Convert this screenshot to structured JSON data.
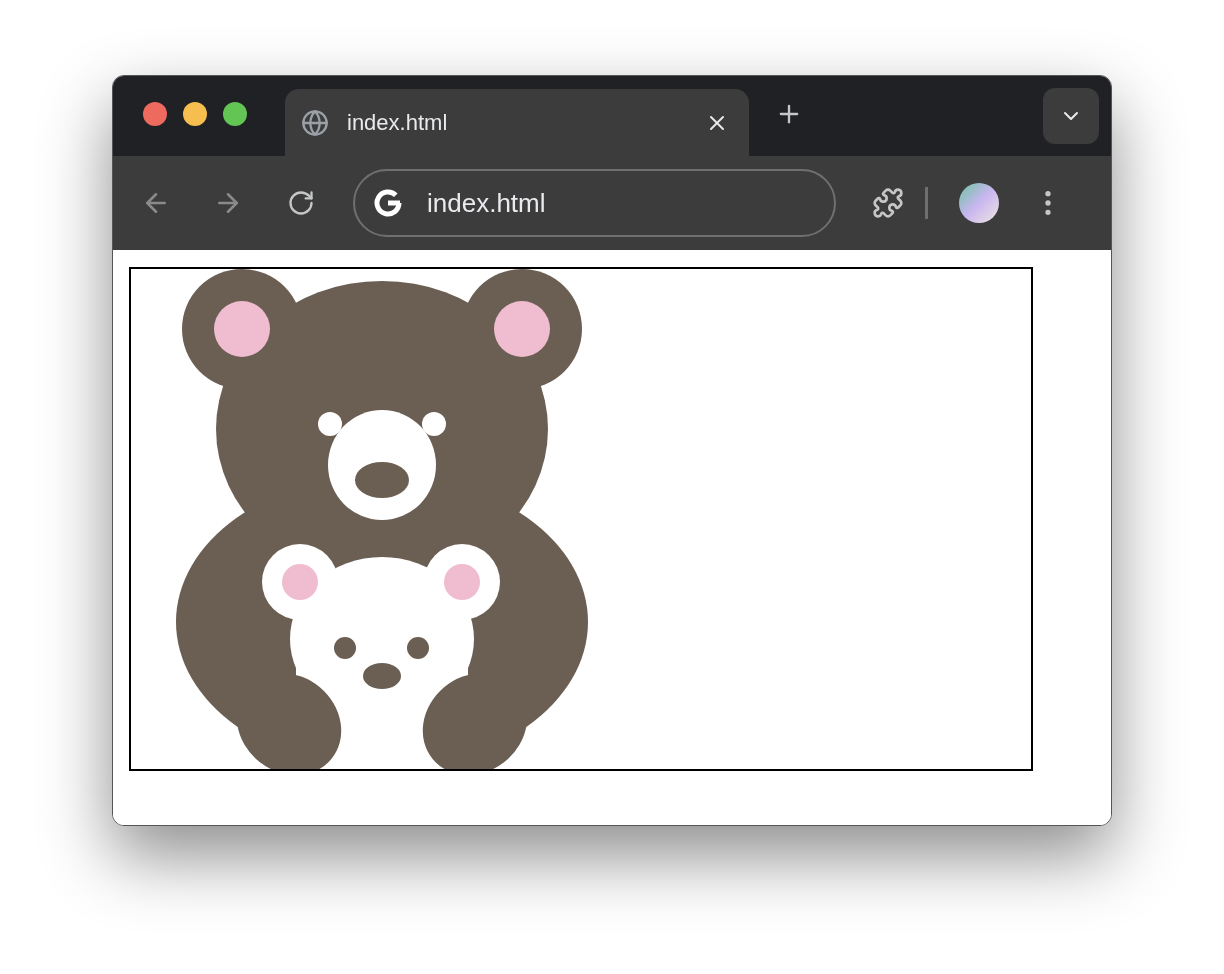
{
  "tab": {
    "title": "index.html"
  },
  "address_bar": {
    "url": "index.html"
  }
}
